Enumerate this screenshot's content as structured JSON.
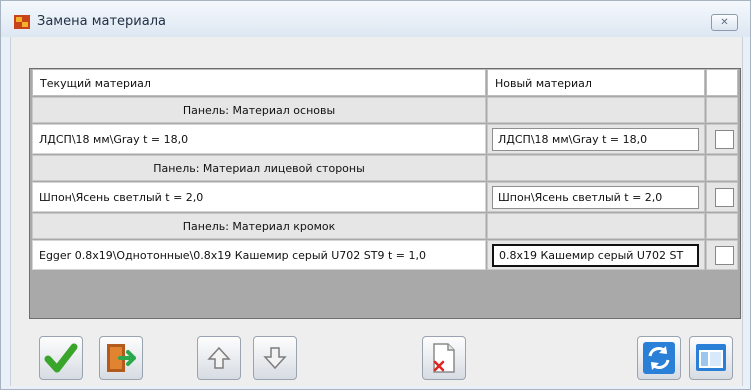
{
  "window": {
    "title": "Замена материала",
    "close_glyph": "✕"
  },
  "table": {
    "headers": {
      "current": "Текущий материал",
      "new": "Новый материал",
      "check": ""
    },
    "groups": [
      {
        "title": "Панель: Материал основы",
        "current": "ЛДСП\\18 мм\\Gray t = 18,0",
        "new": "ЛДСП\\18 мм\\Gray t = 18,0",
        "active": false
      },
      {
        "title": "Панель: Материал лицевой стороны",
        "current": "Шпон\\Ясень светлый t = 2,0",
        "new": "Шпон\\Ясень светлый t = 2,0",
        "active": false
      },
      {
        "title": "Панель: Материал кромок",
        "current": "Egger 0.8x19\\Однотонные\\0.8x19 Кашемир серый U702 ST9 t = 1,0",
        "new": "0.8x19 Кашемир серый U702 ST",
        "active": true
      }
    ]
  },
  "toolbar": {
    "icons": [
      "checkmark-icon",
      "exit-door-icon",
      "arrow-up-icon",
      "arrow-down-icon",
      "document-delete-icon",
      "refresh-icon",
      "window-layout-icon"
    ]
  },
  "colors": {
    "accent_green": "#3aa52b",
    "accent_blue": "#2a7fd6",
    "delete_red": "#e0241f"
  }
}
